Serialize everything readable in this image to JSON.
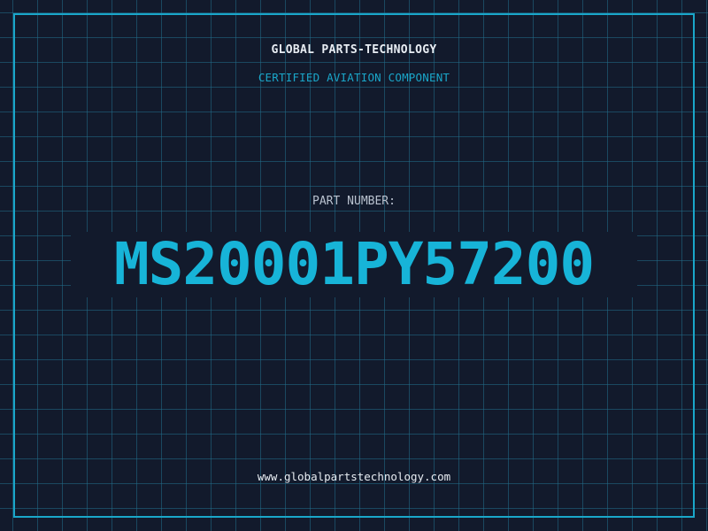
{
  "company": "GLOBAL PARTS-TECHNOLOGY",
  "subtitle": "CERTIFIED AVIATION COMPONENT",
  "part_label": "PART NUMBER:",
  "part_number": "MS20001PY57200",
  "website": "www.globalpartstechnology.com",
  "colors": {
    "background": "#121a2c",
    "accent": "#1aa6c9",
    "text": "#e8edf3",
    "muted": "#b9c2cf"
  }
}
